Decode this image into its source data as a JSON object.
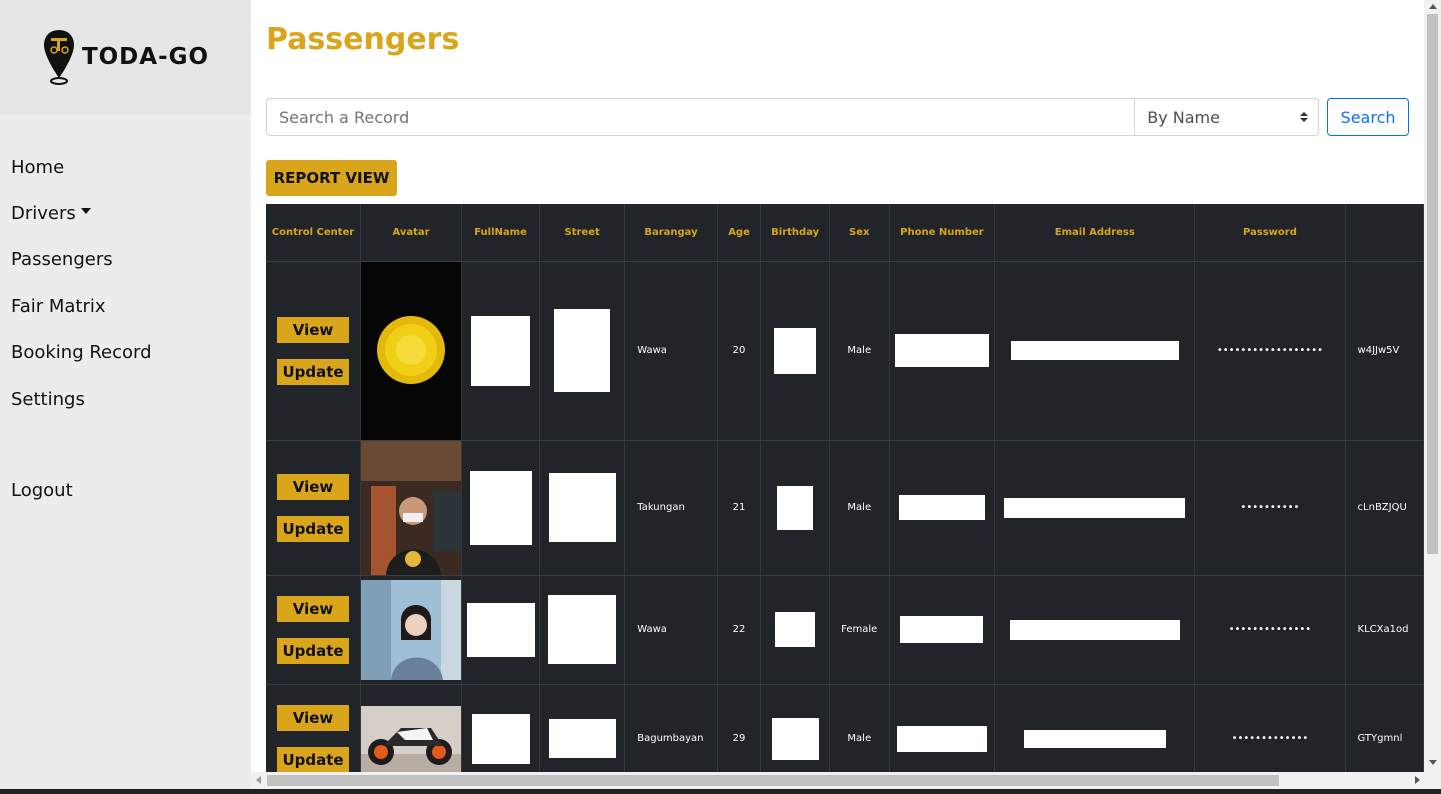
{
  "brand": {
    "name": "TODA-GO"
  },
  "sidebar": {
    "items": [
      {
        "label": "Home"
      },
      {
        "label": "Drivers"
      },
      {
        "label": "Passengers"
      },
      {
        "label": "Fair Matrix"
      },
      {
        "label": "Booking Record"
      },
      {
        "label": "Settings"
      }
    ],
    "logout": "Logout"
  },
  "page": {
    "title": "Passengers"
  },
  "search": {
    "placeholder": "Search a Record",
    "filter_value": "By Name",
    "button": "Search"
  },
  "report_button": "REPORT VIEW",
  "table": {
    "headers": [
      "Control Center",
      "Avatar",
      "FullName",
      "Street",
      "Barangay",
      "Age",
      "Birthday",
      "Sex",
      "Phone Number",
      "Email Address",
      "Password",
      ""
    ],
    "view_label": "View",
    "update_label": "Update",
    "rows": [
      {
        "barangay": "Wawa",
        "age": "20",
        "sex": "Male",
        "password": "••••••••••••••••••",
        "token": "w4JJw5V",
        "avatar": "yellow-flower-photo"
      },
      {
        "barangay": "Takungan",
        "age": "21",
        "sex": "Male",
        "password": "••••••••••",
        "token": "cLnBZJQU",
        "avatar": "man-with-mask-photo"
      },
      {
        "barangay": "Wawa",
        "age": "22",
        "sex": "Female",
        "password": "••••••••••••••",
        "token": "KLCXa1od",
        "avatar": "woman-portrait-photo"
      },
      {
        "barangay": "Bagumbayan",
        "age": "29",
        "sex": "Male",
        "password": "•••••••••••••",
        "token": "GTYgmnl",
        "avatar": "motorcycle-photo"
      }
    ]
  },
  "colors": {
    "accent": "#d9a51b",
    "table_bg": "#212529",
    "sidebar_bg": "#ececec"
  }
}
